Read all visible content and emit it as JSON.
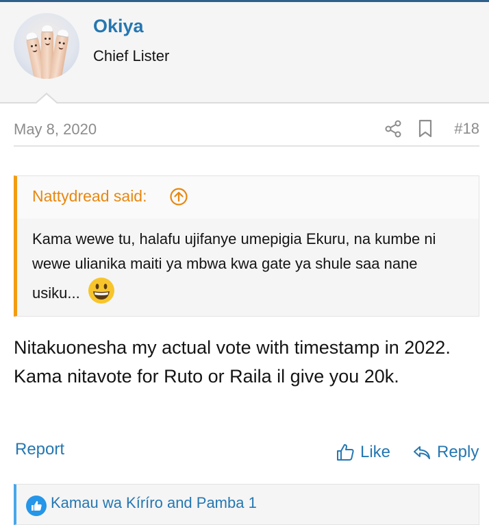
{
  "colors": {
    "accent": "#2577b1",
    "quote_bar": "#f39c12",
    "quote_author": "#e8870f",
    "reaction_bar": "#47a7eb",
    "muted_text": "#8c8c8c"
  },
  "user": {
    "username": "Okiya",
    "title": "Chief Lister",
    "avatar_icon": "avatar-fingers-image"
  },
  "post": {
    "date": "May 8, 2020",
    "number": "#18",
    "quote": {
      "author": "Nattydread said:",
      "text": "Kama wewe tu, halafu ujifanye umepigia Ekuru, na kumbe ni wewe ulianika maiti ya mbwa kwa gate ya shule saa nane usiku...",
      "emoji_icon": "grinning-face-emoji"
    },
    "body": "Nitakuonesha my actual vote with timestamp in 2022. Kama nitavote for Ruto or Raila il give you 20k."
  },
  "actions": {
    "report_label": "Report",
    "like_label": "Like",
    "reply_label": "Reply"
  },
  "reactions": {
    "text": "Kamau wa Kíríro and Pamba 1",
    "icon": "thumbs-up-reaction-icon"
  }
}
